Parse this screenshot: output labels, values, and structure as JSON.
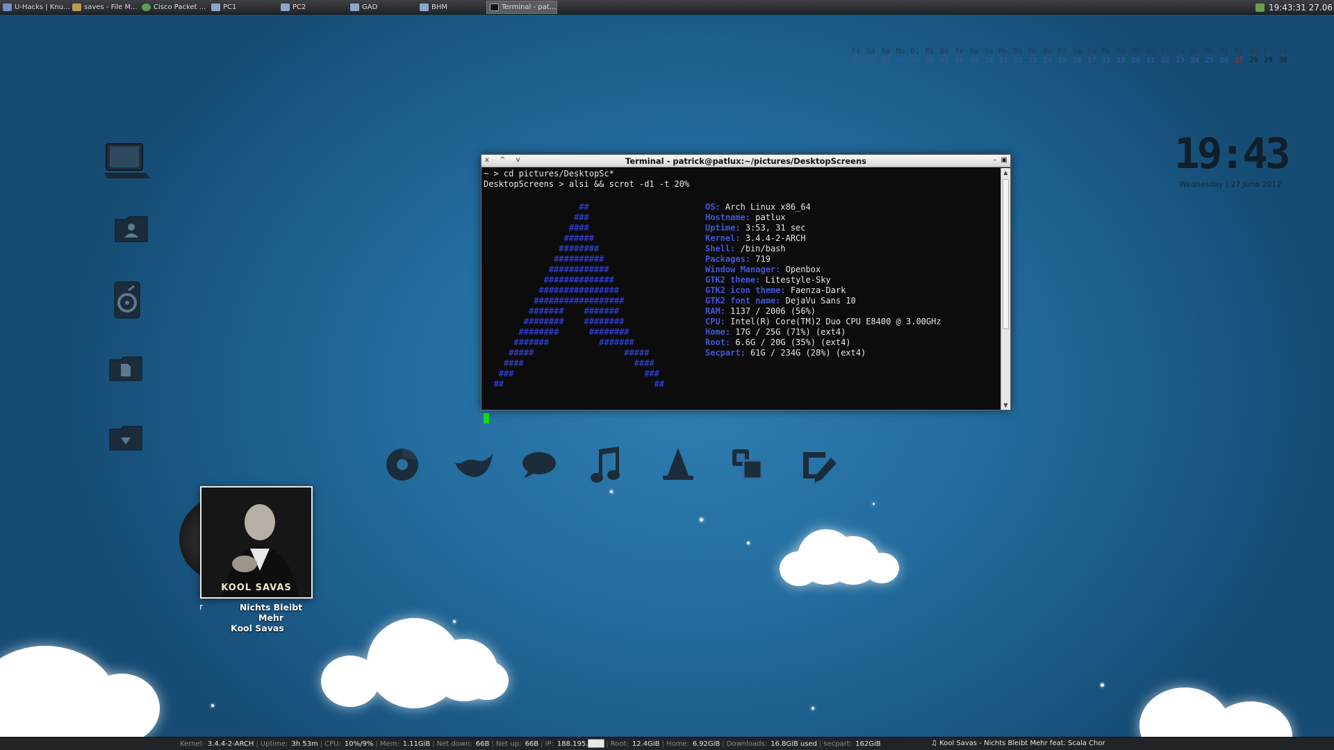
{
  "taskbar": {
    "tasks": [
      {
        "label": "U-Hacks | Knu...",
        "icon": "browser-page-icon"
      },
      {
        "label": "saves - File M...",
        "icon": "folder-icon"
      },
      {
        "label": "Cisco Packet ...",
        "icon": "packet-tracer-icon"
      },
      {
        "label": "PC1",
        "icon": "window-icon"
      },
      {
        "label": "PC2",
        "icon": "window-icon"
      },
      {
        "label": "GAD",
        "icon": "window-icon"
      },
      {
        "label": "BHM",
        "icon": "window-icon"
      },
      {
        "label": "Terminal - pat...",
        "icon": "terminal-icon",
        "active": true
      }
    ],
    "tray_clock": "19:43:31 27.06"
  },
  "calendar": {
    "days": [
      {
        "n": "Fr",
        "d": "01"
      },
      {
        "n": "Sa",
        "d": "02"
      },
      {
        "n": "So",
        "d": "03"
      },
      {
        "n": "Mo",
        "d": "04"
      },
      {
        "n": "Di",
        "d": "05"
      },
      {
        "n": "Mi",
        "d": "06"
      },
      {
        "n": "Do",
        "d": "07"
      },
      {
        "n": "Fr",
        "d": "08"
      },
      {
        "n": "Sa",
        "d": "09"
      },
      {
        "n": "So",
        "d": "10"
      },
      {
        "n": "Mo",
        "d": "11"
      },
      {
        "n": "Di",
        "d": "12"
      },
      {
        "n": "Mi",
        "d": "13"
      },
      {
        "n": "Do",
        "d": "14"
      },
      {
        "n": "Fr",
        "d": "15"
      },
      {
        "n": "Sa",
        "d": "16"
      },
      {
        "n": "So",
        "d": "17"
      },
      {
        "n": "Mo",
        "d": "18"
      },
      {
        "n": "Di",
        "d": "19"
      },
      {
        "n": "Mi",
        "d": "20"
      },
      {
        "n": "Do",
        "d": "21"
      },
      {
        "n": "Fr",
        "d": "22"
      },
      {
        "n": "Sa",
        "d": "23"
      },
      {
        "n": "So",
        "d": "24"
      },
      {
        "n": "Mo",
        "d": "25"
      },
      {
        "n": "Di",
        "d": "26"
      },
      {
        "n": "Mi",
        "d": "27",
        "today": true
      },
      {
        "n": "Do",
        "d": "28"
      },
      {
        "n": "Fr",
        "d": "29"
      },
      {
        "n": "Sa",
        "d": "30"
      }
    ]
  },
  "clock": {
    "time": "19:43",
    "date": "Wednesday | 27 June 2012"
  },
  "terminal": {
    "title": "Terminal - patrick@patlux:~/pictures/DesktopScreens",
    "window_buttons": "x ^ v",
    "line1": "~ > cd pictures/DesktopSc*",
    "line2": "DesktopScreens > alsi && scrot -d1 -t 20%",
    "info": [
      {
        "k": "OS:",
        "v": "Arch Linux x86_64"
      },
      {
        "k": "Hostname:",
        "v": "patlux"
      },
      {
        "k": "Uptime:",
        "v": "3:53, 31 sec"
      },
      {
        "k": "Kernel:",
        "v": "3.4.4-2-ARCH"
      },
      {
        "k": "Shell:",
        "v": "/bin/bash"
      },
      {
        "k": "Packages:",
        "v": "719"
      },
      {
        "k": "Window Manager:",
        "v": "Openbox"
      },
      {
        "k": "GTK2 theme:",
        "v": "Litestyle-Sky"
      },
      {
        "k": "GTK2 icon theme:",
        "v": "Faenza-Dark"
      },
      {
        "k": "GTK2 font name:",
        "v": "DejaVu Sans 10"
      },
      {
        "k": "RAM:",
        "v": "1137 / 2006 (56%)"
      },
      {
        "k": "CPU:",
        "v": "Intel(R) Core(TM)2 Duo CPU E8400 @ 3.00GHz"
      },
      {
        "k": "Home:",
        "v": "17G / 25G (71%) (ext4)"
      },
      {
        "k": "Root:",
        "v": "6.6G / 20G (35%) (ext4)"
      },
      {
        "k": "Secpart:",
        "v": "61G / 234G (28%) (ext4)"
      }
    ]
  },
  "left_icons": [
    "computer-icon",
    "home-folder-icon",
    "media-drive-icon",
    "documents-folder-icon",
    "downloads-folder-icon"
  ],
  "dock": [
    "chrome-icon",
    "thunderbird-icon",
    "chat-icon",
    "music-icon",
    "vlc-icon",
    "virtualbox-icon",
    "editor-icon"
  ],
  "music": {
    "album_text": "KOOL SAVAS",
    "left_char": "r",
    "track": "Nichts Bleibt Mehr",
    "artist": "Kool Savas"
  },
  "statusbar": [
    {
      "k": "Kernel:",
      "v": "3.4.4-2-ARCH"
    },
    {
      "k": "Uptime:",
      "v": "3h 53m"
    },
    {
      "k": "CPU:",
      "v": "10%/9%"
    },
    {
      "k": "Mem:",
      "v": "1.11GiB"
    },
    {
      "k": "Net down:",
      "v": "66B"
    },
    {
      "k": "Net up:",
      "v": "66B"
    },
    {
      "k": "IP:",
      "v": "188.195.███"
    },
    {
      "k": "Root:",
      "v": "12.4GiB"
    },
    {
      "k": "Home:",
      "v": "6.92GiB"
    },
    {
      "k": "Downloads:",
      "v": "16.8GiB used"
    },
    {
      "k": "secpart:",
      "v": "162GiB"
    }
  ],
  "now_playing": "♫ Kool Savas - Nichts Bleibt Mehr feat. Scala Chor",
  "colors": {
    "accent": "#2f7db1",
    "terminal_bg": "#0c0c0c",
    "info_key": "#4454d8",
    "cursor": "#1ad51a"
  }
}
